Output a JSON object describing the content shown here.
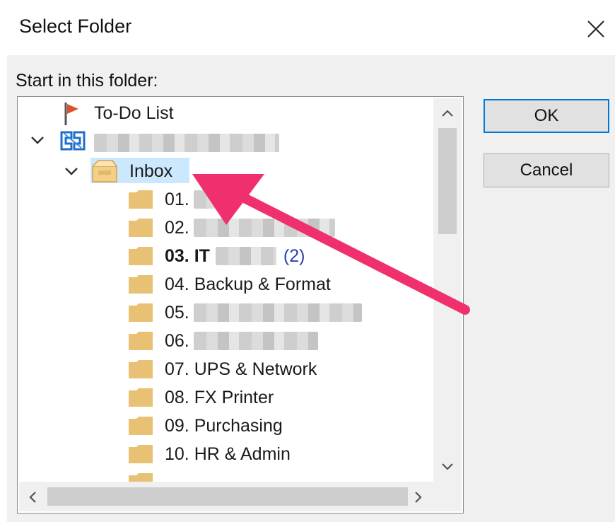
{
  "dialog": {
    "title": "Select Folder",
    "start_label": "Start in this folder:"
  },
  "tree": {
    "items": [
      {
        "label": "To-Do List"
      },
      {
        "label": ""
      },
      {
        "label": "Inbox",
        "selected": true
      },
      {
        "label": "01."
      },
      {
        "label": "02."
      },
      {
        "label": "03. IT",
        "bold": true,
        "count": "(2)"
      },
      {
        "label": "04. Backup & Format"
      },
      {
        "label": "05."
      },
      {
        "label": "06."
      },
      {
        "label": "07. UPS & Network"
      },
      {
        "label": "08. FX Printer"
      },
      {
        "label": "09. Purchasing"
      },
      {
        "label": "10. HR & Admin"
      }
    ]
  },
  "buttons": {
    "ok": "OK",
    "cancel": "Cancel"
  },
  "colors": {
    "accent": "#0078d7",
    "selection": "#cce8ff",
    "arrow": "#f0306d",
    "folder": "#e8c174",
    "count": "#2b3fb0"
  }
}
